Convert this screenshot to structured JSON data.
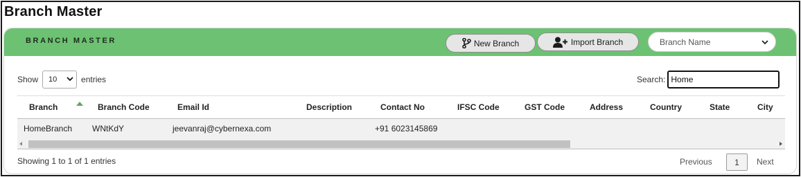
{
  "page": {
    "title": "Branch Master"
  },
  "header": {
    "title": "BRANCH MASTER",
    "new_branch_label": "New Branch",
    "import_branch_label": "Import Branch",
    "branch_select_value": "Branch Name",
    "accent_color": "#6cc272"
  },
  "controls": {
    "show_label": "Show",
    "entries_value": "10",
    "entries_label": "entries",
    "search_label": "Search:",
    "search_value": "Home"
  },
  "table": {
    "columns": [
      "Branch",
      "Branch Code",
      "Email Id",
      "Description",
      "Contact No",
      "IFSC Code",
      "GST Code",
      "Address",
      "Country",
      "State",
      "City"
    ],
    "sorted_column": "Branch",
    "sort_direction": "ascending",
    "rows": [
      [
        "HomeBranch",
        "WNtKdY",
        "jeevanraj@cybernexa.com",
        "",
        "+91 6023145869",
        "",
        "",
        "",
        "",
        "",
        ""
      ]
    ]
  },
  "footer": {
    "info": "Showing 1 to 1 of 1 entries",
    "previous_label": "Previous",
    "current_page": "1",
    "next_label": "Next"
  },
  "icons": {
    "new_branch": "git-branch-icon",
    "import_branch": "user-plus-icon",
    "dropdown": "chevron-down-icon"
  }
}
